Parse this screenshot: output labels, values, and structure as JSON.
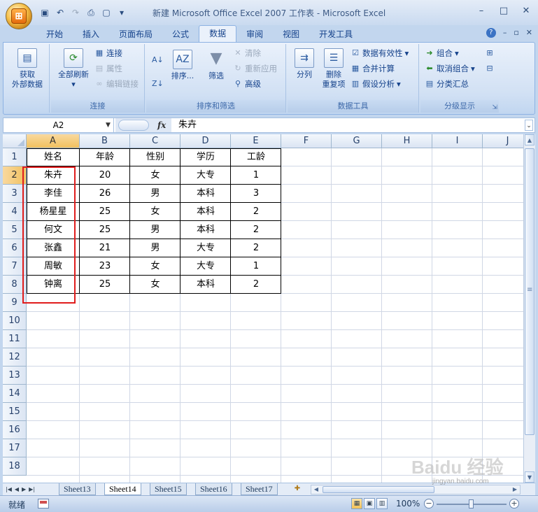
{
  "title": "新建 Microsoft Office Excel 2007 工作表 - Microsoft Excel",
  "office_button": "Office",
  "tabs": [
    "开始",
    "插入",
    "页面布局",
    "公式",
    "数据",
    "审阅",
    "视图",
    "开发工具"
  ],
  "active_tab": "数据",
  "ribbon": {
    "get_external": {
      "line1": "获取",
      "line2": "外部数据"
    },
    "connections": {
      "refresh_all": "全部刷新",
      "connections": "连接",
      "properties": "属性",
      "edit_links": "编辑链接",
      "label": "连接"
    },
    "sort_filter": {
      "sort": "排序...",
      "filter": "筛选",
      "clear": "清除",
      "reapply": "重新应用",
      "advanced": "高级",
      "label": "排序和筛选"
    },
    "data_tools": {
      "text_to_columns": "分列",
      "remove_dup_1": "删除",
      "remove_dup_2": "重复项",
      "validation": "数据有效性",
      "consolidate": "合并计算",
      "what_if": "假设分析",
      "label": "数据工具"
    },
    "outline": {
      "group": "组合",
      "ungroup": "取消组合",
      "subtotal": "分类汇总",
      "label": "分级显示"
    }
  },
  "formula_bar": {
    "name_box": "A2",
    "fx": "fx",
    "content": "朱卉"
  },
  "columns": [
    "A",
    "B",
    "C",
    "D",
    "E",
    "F",
    "G",
    "H",
    "I",
    "J"
  ],
  "rows": [
    "1",
    "2",
    "3",
    "4",
    "5",
    "6",
    "7",
    "8",
    "9",
    "10",
    "11",
    "12",
    "13",
    "14",
    "15",
    "16",
    "17",
    "18"
  ],
  "table": {
    "headers": [
      "姓名",
      "年龄",
      "性别",
      "学历",
      "工龄"
    ],
    "rows": [
      [
        "朱卉",
        "20",
        "女",
        "大专",
        "1"
      ],
      [
        "李佳",
        "26",
        "男",
        "本科",
        "3"
      ],
      [
        "杨星星",
        "25",
        "女",
        "本科",
        "2"
      ],
      [
        "何文",
        "25",
        "男",
        "本科",
        "2"
      ],
      [
        "张鑫",
        "21",
        "男",
        "大专",
        "2"
      ],
      [
        "周敏",
        "23",
        "女",
        "大专",
        "1"
      ],
      [
        "钟离",
        "25",
        "女",
        "本科",
        "2"
      ]
    ]
  },
  "sheets": [
    "Sheet13",
    "Sheet14",
    "Sheet15",
    "Sheet16",
    "Sheet17"
  ],
  "active_sheet": "Sheet14",
  "status": {
    "ready": "就绪",
    "zoom": "100%"
  },
  "watermark": {
    "brand": "Baidu 经验",
    "url": "jingyan.baidu.com"
  },
  "colors": {
    "highlight_box": "#e01c1c",
    "ribbon_bg": "#d2e1f4"
  }
}
